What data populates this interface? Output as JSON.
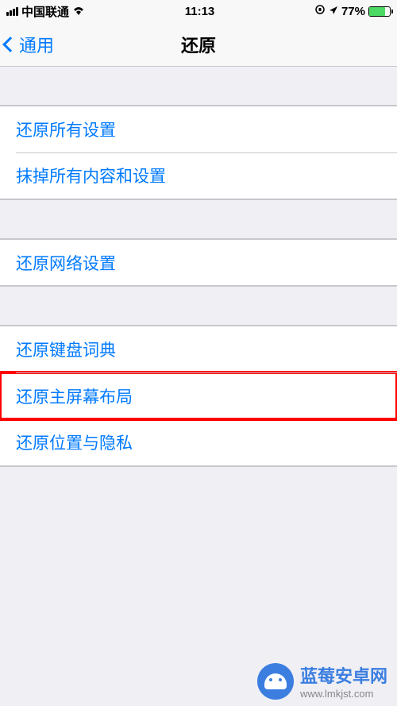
{
  "status": {
    "carrier": "中国联通",
    "time": "11:13",
    "battery_percent": "77%"
  },
  "nav": {
    "back_label": "通用",
    "title": "还原"
  },
  "sections": {
    "group1": {
      "reset_all_settings": "还原所有设置",
      "erase_all": "抹掉所有内容和设置"
    },
    "group2": {
      "reset_network": "还原网络设置"
    },
    "group3": {
      "reset_keyboard": "还原键盘词典",
      "reset_home_layout": "还原主屏幕布局",
      "reset_location_privacy": "还原位置与隐私"
    }
  },
  "watermark": {
    "title": "蓝莓安卓网",
    "url": "www.lmkjst.com"
  }
}
